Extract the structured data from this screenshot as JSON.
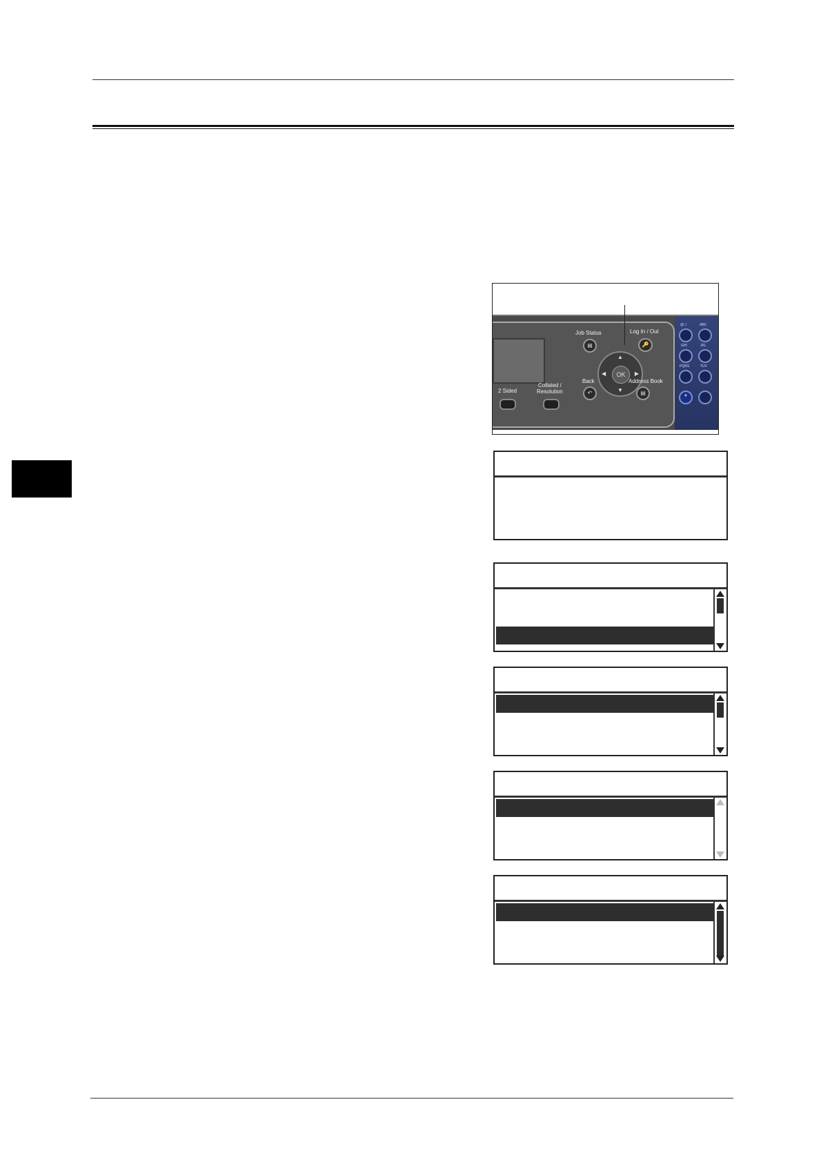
{
  "control_panel": {
    "job_status_label": "Job Status",
    "log_in_out_label": "Log In / Out",
    "back_label": "Back",
    "address_book_label": "Address Book",
    "ok_label": "OK",
    "two_sided_label": "2 Sided",
    "collated_resolution_label": "Collated /\nResolution",
    "keypad_labels": [
      "@:./",
      "ABC",
      "GHI",
      "JKL",
      "PQRS",
      "TUV"
    ],
    "star_key": "*",
    "highlighted_button": "Log In / Out"
  }
}
